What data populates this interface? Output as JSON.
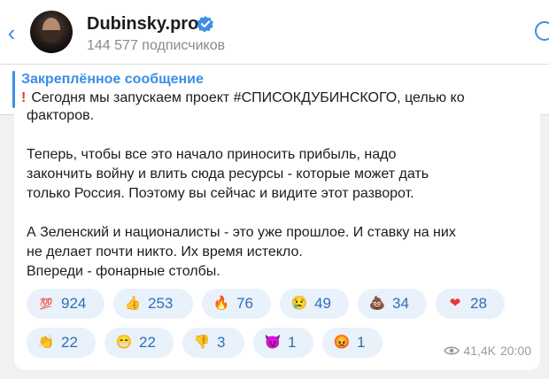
{
  "header": {
    "back_icon": "chevron-left-icon",
    "title": "Dubinsky.pro",
    "subscribers": "144 577 подписчиков",
    "verified_icon": "verified-badge-icon",
    "search_icon": "search-icon"
  },
  "pinned": {
    "label": "Закреплённое сообщение",
    "text": "Сегодня мы запускаем проект #СПИСОКДУБИНСКОГО, целью ко"
  },
  "message": {
    "cut_line": "факторов.",
    "paragraph1": [
      "Теперь, чтобы все это начало приносить прибыль, надо",
      "закончить войну и влить сюда ресурсы - которые может дать",
      "только Россия. Поэтому вы сейчас и видите этот разворот."
    ],
    "paragraph2": [
      "А Зеленский и националисты - это уже прошлое. И ставку на них",
      "не делает почти никто. Их время истекло.",
      "Впереди - фонарные столбы."
    ],
    "views": "41,4K",
    "time": "20:00"
  },
  "reactions": [
    {
      "emoji": "💯",
      "count": "924"
    },
    {
      "emoji": "👍",
      "count": "253"
    },
    {
      "emoji": "🔥",
      "count": "76"
    },
    {
      "emoji": "😢",
      "count": "49"
    },
    {
      "emoji": "💩",
      "count": "34"
    },
    {
      "emoji": "❤",
      "count": "28"
    },
    {
      "emoji": "👏",
      "count": "22"
    },
    {
      "emoji": "😁",
      "count": "22"
    },
    {
      "emoji": "👎",
      "count": "3"
    },
    {
      "emoji": "😈",
      "count": "1"
    },
    {
      "emoji": "😡",
      "count": "1"
    }
  ],
  "colors": {
    "accent": "#3a8ee6",
    "reaction_bg": "#e9f1fb",
    "reaction_text": "#2f6fb3",
    "pinned_exclamation": "#e53935"
  }
}
